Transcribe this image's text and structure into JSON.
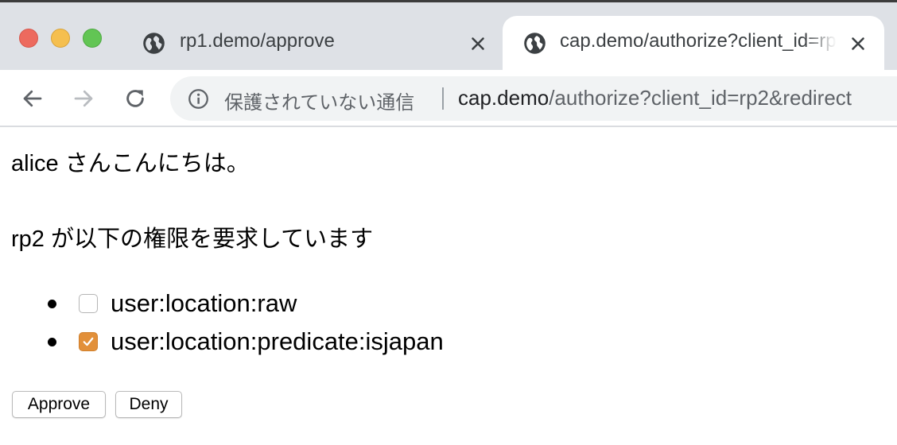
{
  "browser": {
    "tabs": [
      {
        "title": "rp1.demo/approve",
        "active": false
      },
      {
        "title": "cap.demo/authorize?client_id=rp2&redirect",
        "active": true
      }
    ],
    "address_bar": {
      "security_text": "保護されていない通信",
      "url_host": "cap.demo",
      "url_path": "/authorize?client_id=rp2&redirect"
    },
    "icons": {
      "close": "close-icon",
      "tab_favicon": "globe-icon",
      "back": "back-arrow-icon",
      "forward": "forward-arrow-icon",
      "reload": "reload-icon",
      "info": "info-icon"
    }
  },
  "page": {
    "greeting": "alice さんこんにちは。",
    "request_text": "rp2 が以下の権限を要求しています",
    "scopes": [
      {
        "label": "user:location:raw",
        "checked": false
      },
      {
        "label": "user:location:predicate:isjapan",
        "checked": true
      }
    ],
    "buttons": {
      "approve": "Approve",
      "deny": "Deny"
    }
  },
  "colors": {
    "tabstrip": "#dee1e6",
    "checkbox_accent": "#e2903a"
  }
}
